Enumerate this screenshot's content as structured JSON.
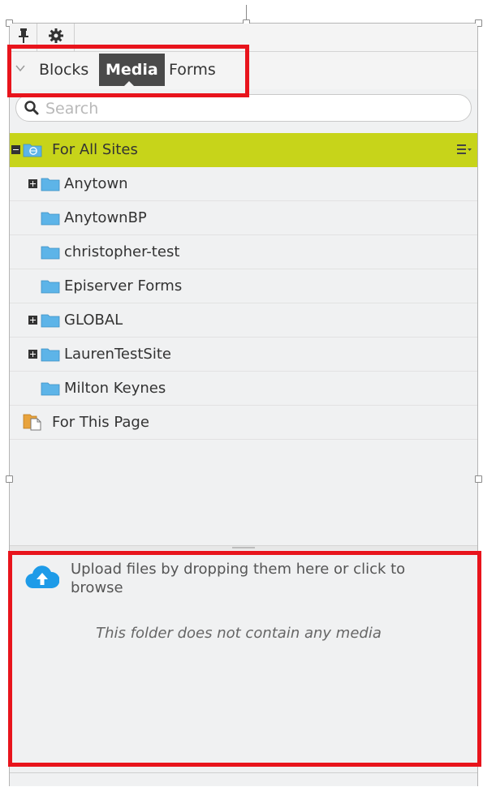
{
  "toolbar": {
    "pin_icon": "pin-icon",
    "settings_icon": "gear-icon"
  },
  "tabs": [
    {
      "label": "Blocks",
      "active": false
    },
    {
      "label": "Media",
      "active": true
    },
    {
      "label": "Forms",
      "active": false
    }
  ],
  "search": {
    "placeholder": "Search",
    "value": ""
  },
  "tree": {
    "root": {
      "label": "For All Sites",
      "icon": "globe-folder-icon",
      "selected": true
    },
    "children": [
      {
        "label": "Anytown",
        "expandable": true
      },
      {
        "label": "AnytownBP",
        "expandable": false
      },
      {
        "label": "christopher-test",
        "expandable": false
      },
      {
        "label": "Episerver Forms",
        "expandable": false
      },
      {
        "label": "GLOBAL",
        "expandable": true
      },
      {
        "label": "LaurenTestSite",
        "expandable": true
      },
      {
        "label": "Milton Keynes",
        "expandable": false
      }
    ],
    "page_folder": {
      "label": "For This Page",
      "icon": "page-folder-icon"
    }
  },
  "upload": {
    "text": "Upload files by dropping them here or click to browse",
    "empty_message": "This folder does not contain any media",
    "icon": "cloud-upload-icon"
  },
  "colors": {
    "selected_row": "#c7d41a",
    "active_tab": "#4a4a4a",
    "callout_border": "#e8141c",
    "folder_blue": "#5db4e8",
    "upload_icon": "#1e9be8"
  }
}
